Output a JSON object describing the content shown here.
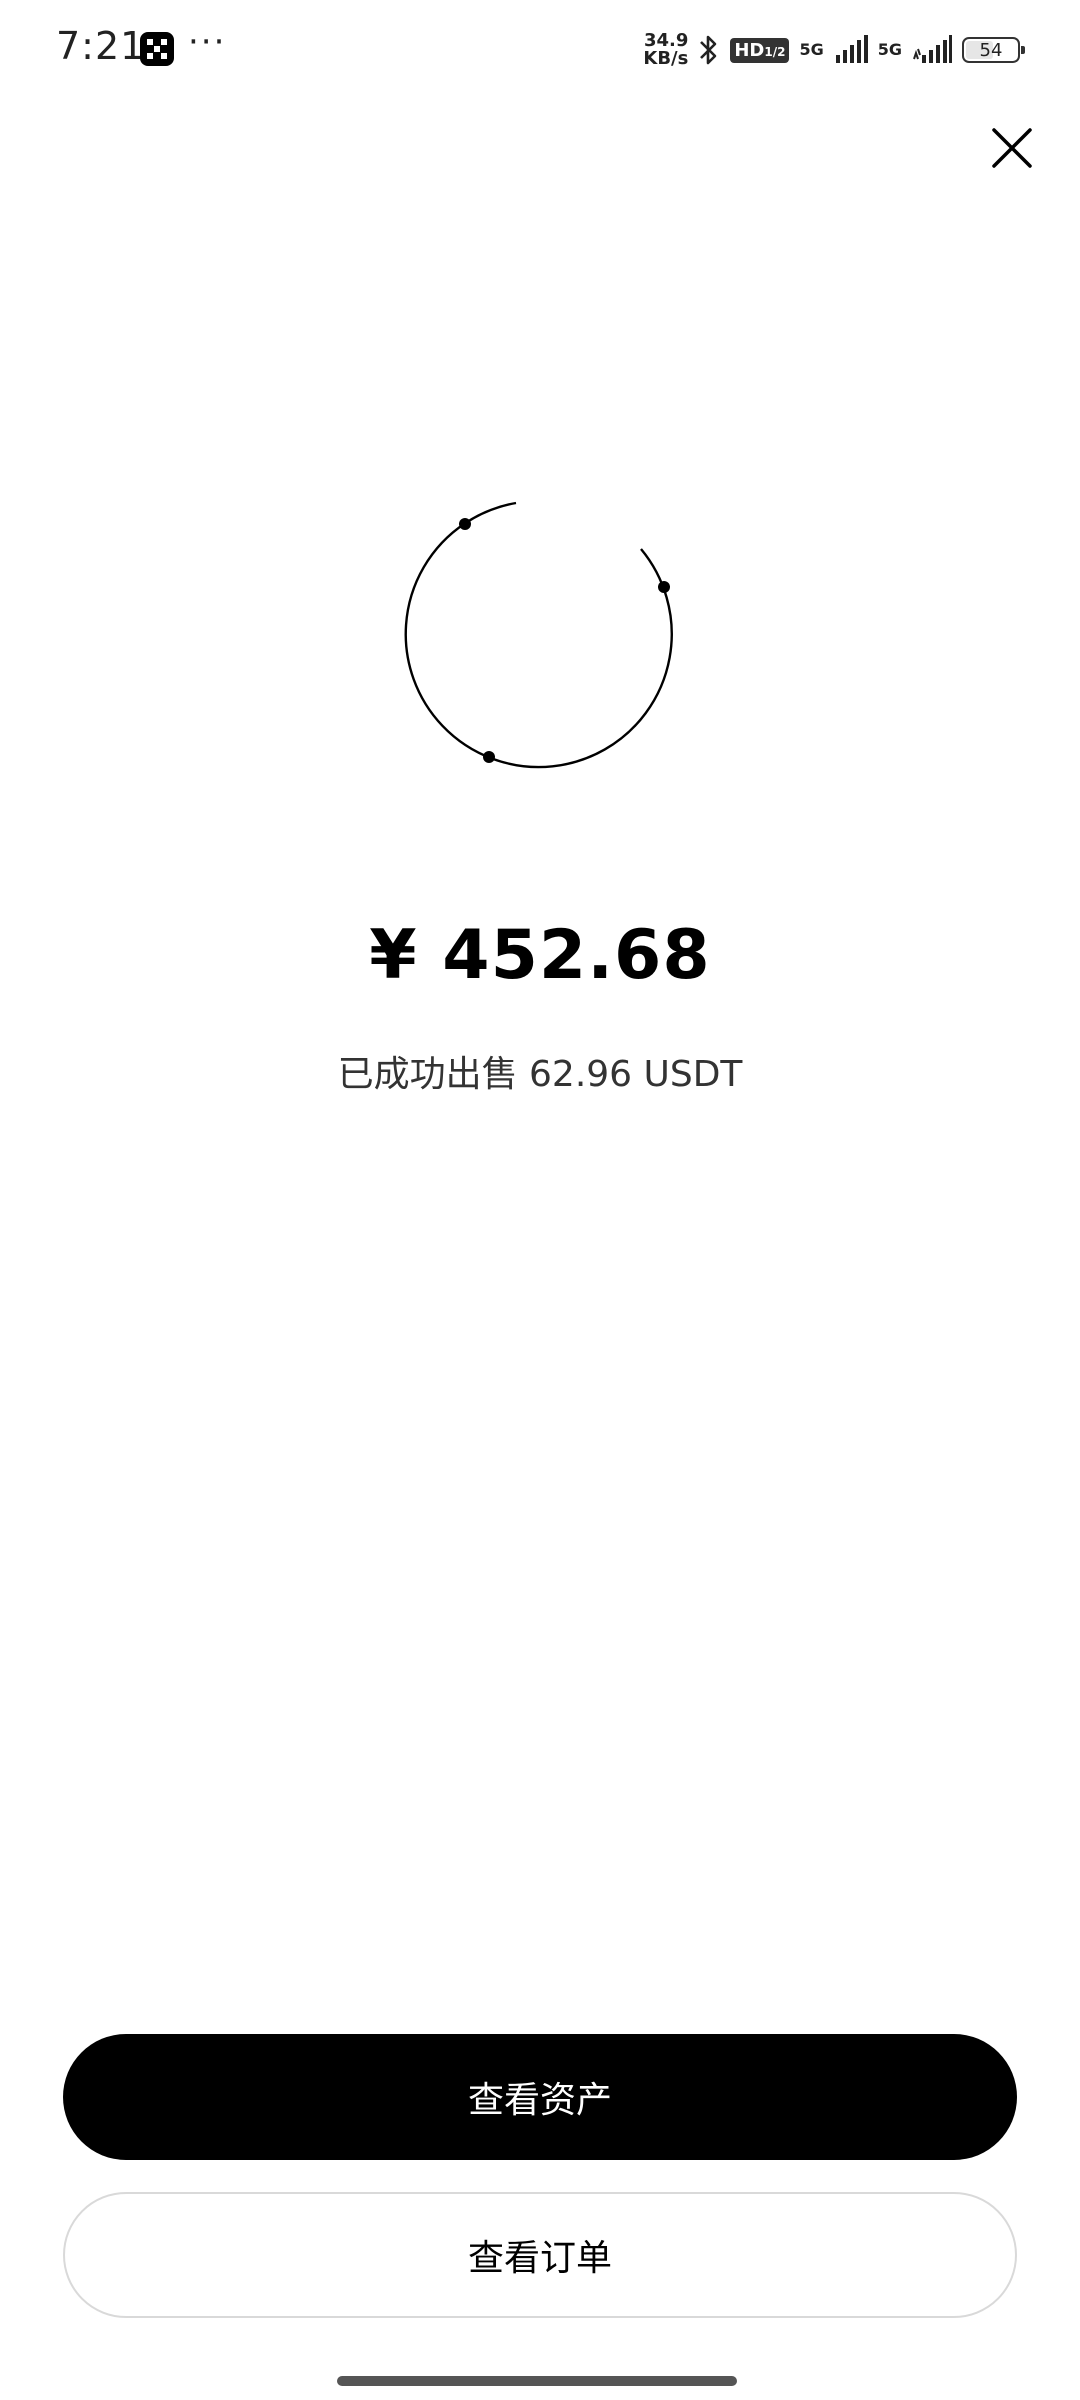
{
  "status_bar": {
    "time": "7:21",
    "more": "···",
    "net_speed_value": "34.9",
    "net_speed_unit": "KB/s",
    "hd_label": "HD",
    "hd_sub": "1/2",
    "sim1_label": "5G",
    "sim2_label": "5G",
    "battery_level": "54",
    "battery_fraction": 0.54,
    "icons": [
      "okx-app-icon",
      "bluetooth-icon",
      "signal-icon",
      "battery-icon"
    ]
  },
  "main": {
    "amount": "¥ 452.68",
    "sold_text": "已成功出售 62.96 USDT"
  },
  "actions": {
    "view_assets_label": "查看资产",
    "view_orders_label": "查看订单"
  },
  "colors": {
    "primary_button_bg": "#000000",
    "primary_button_text": "#ffffff",
    "secondary_button_border": "#d9d9d9",
    "background": "#ffffff"
  }
}
